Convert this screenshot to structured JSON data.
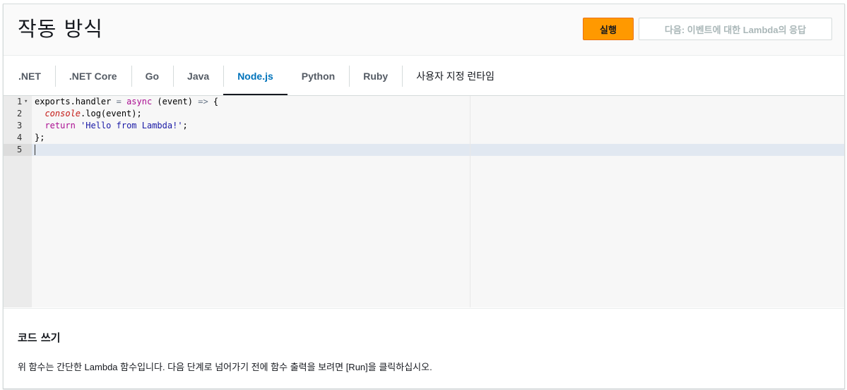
{
  "header": {
    "title": "작동 방식",
    "run_label": "실행",
    "next_label": "다음: 이벤트에 대한 Lambda의 응답"
  },
  "tabs": [
    {
      "label": ".NET",
      "active": false
    },
    {
      "label": ".NET Core",
      "active": false
    },
    {
      "label": "Go",
      "active": false
    },
    {
      "label": "Java",
      "active": false
    },
    {
      "label": "Node.js",
      "active": true
    },
    {
      "label": "Python",
      "active": false
    },
    {
      "label": "Ruby",
      "active": false
    },
    {
      "label": "사용자 지정 런타임",
      "active": false
    }
  ],
  "editor": {
    "line_numbers": [
      "1",
      "2",
      "3",
      "4",
      "5"
    ],
    "lines": [
      "exports.handler = async (event) => {",
      "  console.log(event);",
      "  return 'Hello from Lambda!';",
      "};",
      ""
    ],
    "current_line": 5
  },
  "description": {
    "title": "코드 쓰기",
    "text": "위 함수는 간단한 Lambda 함수입니다. 다음 단계로 넘어가기 전에 함수 출력을 보려면 [Run]을 클릭하십시오."
  },
  "colors": {
    "run_button": "#ff9900",
    "active_tab": "#0073bb"
  }
}
